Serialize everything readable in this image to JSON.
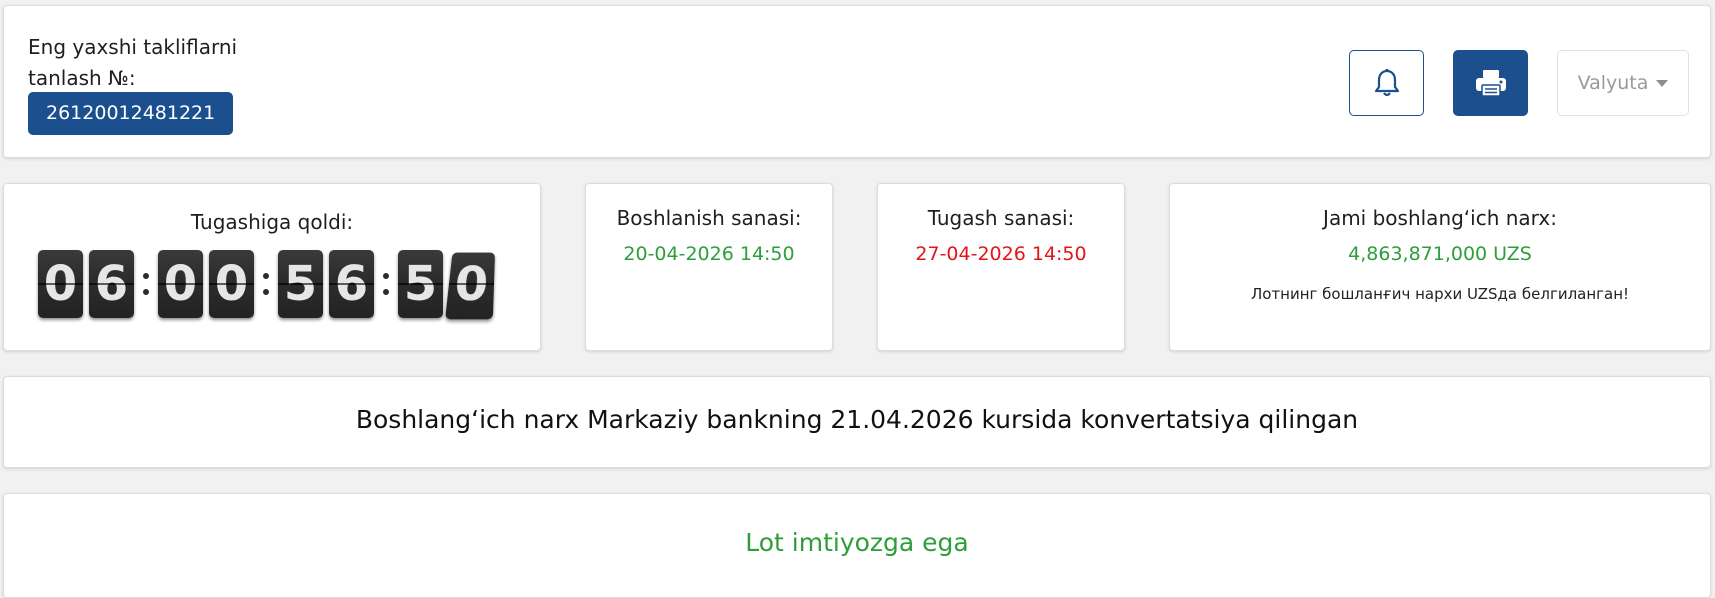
{
  "header": {
    "title_line1": "Eng yaxshi takliflarni",
    "title_line2": "tanlash №:",
    "lot_number": "26120012481221",
    "currency_placeholder": "Valyuta",
    "icons": {
      "bell": "bell-icon",
      "print": "printer-icon",
      "dropdown": "caret-down-icon"
    }
  },
  "timer": {
    "label": "Tugashiga qoldi:",
    "digits": [
      "0",
      "6",
      "0",
      "0",
      "5",
      "6",
      "5",
      "0"
    ]
  },
  "start": {
    "label": "Boshlanish sanasi:",
    "value": "20-04-2026 14:50"
  },
  "end": {
    "label": "Tugash sanasi:",
    "value": "27-04-2026 14:50"
  },
  "price": {
    "label": "Jami boshlangʻich narx:",
    "value": "4,863,871,000 UZS",
    "note": "Лотнинг бошланғич нархи UZSда белгиланган!"
  },
  "conversion_banner": "Boshlangʻich narx Markaziy bankning 21.04.2026 kursida konvertatsiya qilingan",
  "privilege_banner": "Lot imtiyozga ega",
  "colors": {
    "primary": "#1c4f8e",
    "green": "#2e9e3b",
    "red": "#e0161b"
  }
}
